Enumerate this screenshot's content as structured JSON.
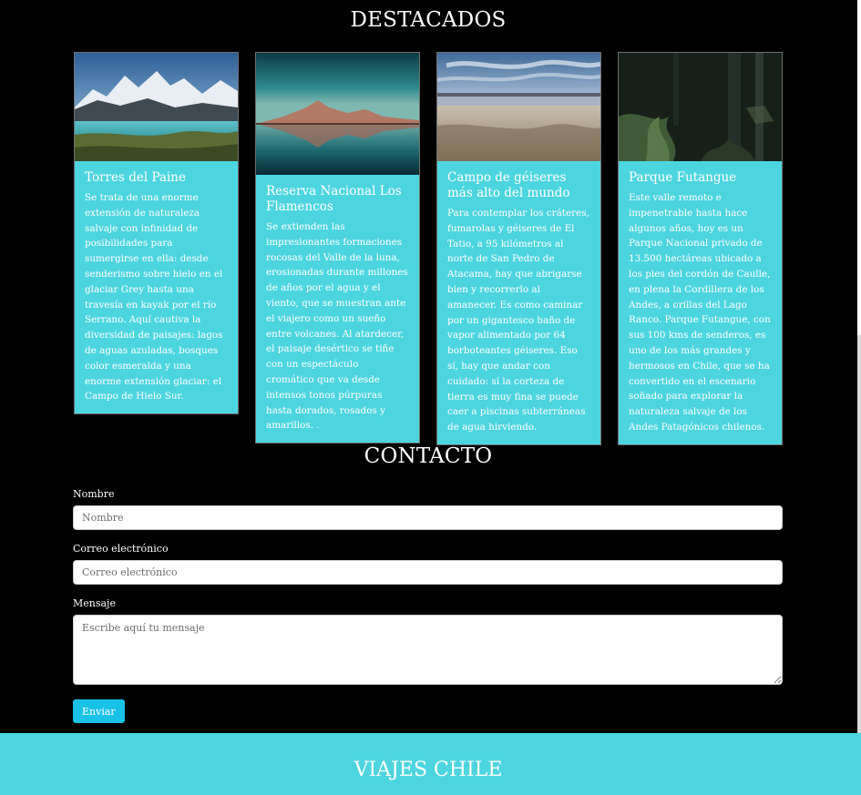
{
  "featured": {
    "title": "DESTACADOS",
    "cards": [
      {
        "title": "Torres del Paine",
        "text": "Se trata de una enorme extensión de naturaleza salvaje con infinidad de posibilidades para sumergirse en ella: desde senderismo sobre hielo en el glaciar Grey hasta una travesía en kayak por el río Serrano. Aquí cautiva la diversidad de paisajes: lagos de aguas azuladas, bosques color esmeralda y una enorme extensión glaciar: el Campo de Hielo Sur."
      },
      {
        "title": "Reserva Nacional Los Flamencos",
        "text": "Se extienden las impresionantes formaciones rocosas del Valle de la luna, erosionadas durante millones de años por el agua y el viento, que se muestran ante el viajero como un sueño entre volcanes. Al atardecer, el paisaje desértico se tiñe con un espectáculo cromático que va desde intensos tonos púrpuras hasta dorados, rosados y amarillos. ."
      },
      {
        "title": "Campo de géiseres más alto del mundo",
        "text": "Para contemplar los cráteres, fumarolas y géiseres de El Tatio, a 95 kilómetros al norte de San Pedro de Atacama, hay que abrigarse bien y recorrerlo al amanecer. Es como caminar por un gigantesco baño de vapor alimentado por 64 borboteantes géiseres. Eso sí, hay que andar con cuidado: si la corteza de tierra es muy fina se puede caer a piscinas subterráneas de agua hirviendo."
      },
      {
        "title": "Parque Futangue",
        "text": "Este valle remoto e impenetrable hasta hace algunos años, hoy es un Parque Nacional privado de 13.500 hectáreas ubicado a los pies del cordón de Caulle, en plena la Cordillera de los Andes, a orillas del Lago Ranco. Parque Futangue, con sus 100 kms de senderos, es uno de los más grandes y hermosos en Chile, que se ha convertido en el escenario soñado para explorar la naturaleza salvaje de los Andes Patagónicos chilenos."
      }
    ]
  },
  "contact": {
    "title": "CONTACTO",
    "name_label": "Nombre",
    "name_placeholder": "Nombre",
    "email_label": "Correo electrónico",
    "email_placeholder": "Correo electrónico",
    "message_label": "Mensaje",
    "message_placeholder": "Escribe aquí tu mensaje",
    "submit_label": "Enviar"
  },
  "footer": {
    "brand": "VIAJES CHILE"
  },
  "colors": {
    "accent": "#4dd5df",
    "button": "#17c2e6",
    "background": "#000000"
  }
}
